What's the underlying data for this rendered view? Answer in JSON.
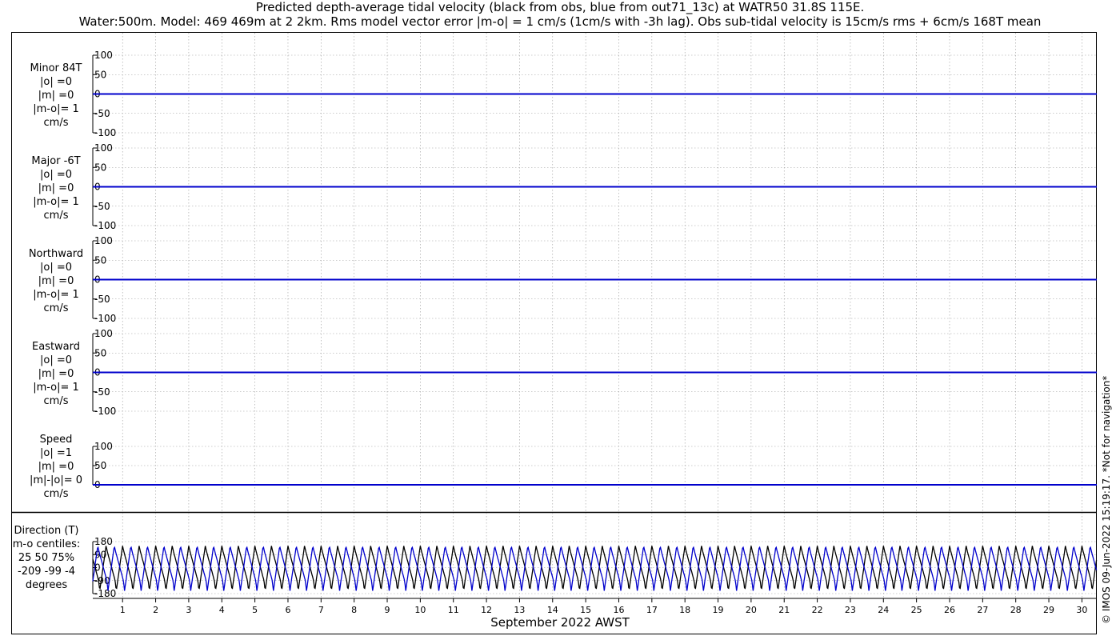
{
  "title_line1": "Predicted depth-average tidal velocity (black from obs, blue from out71_13c) at WATR50 31.8S 115E.",
  "title_line2": "Water:500m. Model: 469 469m at 2 2km. Rms model vector error |m-o| = 1 cm/s (1cm/s with -3h lag). Obs sub-tidal velocity is 15cm/s rms + 6cm/s 168T mean",
  "xlabel": "September 2022 AWST",
  "copyright": "© IMOS 09-Jun-2022 15:19:17. *Not for navigation*",
  "colors": {
    "obs": "#000000",
    "model": "#0000cc",
    "grid": "#999999"
  },
  "panels": [
    {
      "id": "minor",
      "label_lines": [
        "Minor 84T",
        "|o| =0",
        "|m| =0",
        "|m-o|= 1",
        "cm/s"
      ],
      "yticks": [
        "100",
        "50",
        "0",
        "-50",
        "-100"
      ]
    },
    {
      "id": "major",
      "label_lines": [
        "Major -6T",
        "|o| =0",
        "|m| =0",
        "|m-o|= 1",
        "cm/s"
      ],
      "yticks": [
        "100",
        "50",
        "0",
        "-50",
        "-100"
      ]
    },
    {
      "id": "north",
      "label_lines": [
        "Northward",
        "|o| =0",
        "|m| =0",
        "|m-o|= 1",
        "cm/s"
      ],
      "yticks": [
        "100",
        "50",
        "0",
        "-50",
        "-100"
      ]
    },
    {
      "id": "east",
      "label_lines": [
        "Eastward",
        "|o| =0",
        "|m| =0",
        "|m-o|= 1",
        "cm/s"
      ],
      "yticks": [
        "100",
        "50",
        "0",
        "-50",
        "-100"
      ]
    },
    {
      "id": "speed",
      "label_lines": [
        "Speed",
        "|o| =1",
        "|m| =0",
        "|m|-|o|= 0",
        "cm/s"
      ],
      "yticks": [
        "100",
        "50",
        "0"
      ]
    },
    {
      "id": "direction",
      "label_lines": [
        "Direction (T)",
        "m-o centiles:",
        "25  50  75%",
        "-209  -99   -4",
        "degrees"
      ],
      "yticks": [
        "180",
        "90",
        "0",
        "-90",
        "-180"
      ]
    }
  ],
  "chart_data": {
    "type": "line",
    "x_axis": {
      "label": "September 2022 AWST",
      "tick_labels": [
        "1",
        "2",
        "3",
        "4",
        "5",
        "6",
        "7",
        "8",
        "9",
        "10",
        "11",
        "12",
        "13",
        "14",
        "15",
        "16",
        "17",
        "18",
        "19",
        "20",
        "21",
        "22",
        "23",
        "24",
        "25",
        "26",
        "27",
        "28",
        "29",
        "30"
      ],
      "xlim_days": [
        0.1,
        30.45
      ]
    },
    "velocity_panels": {
      "ylim": [
        -100,
        100
      ],
      "series": [
        {
          "name": "obs",
          "values": "approximately 0 cm/s throughout"
        },
        {
          "name": "model",
          "values": "approximately 0 cm/s throughout"
        }
      ]
    },
    "direction_panel": {
      "ylim": [
        -180,
        180
      ],
      "yticks": [
        180,
        90,
        0,
        -90,
        -180
      ],
      "series": [
        {
          "name": "obs",
          "pattern": "semi-diurnal sawtooth, phase 0.00"
        },
        {
          "name": "model",
          "pattern": "semi-diurnal sawtooth, phase 0.25"
        }
      ],
      "tidal_period_days": 1.0
    }
  }
}
